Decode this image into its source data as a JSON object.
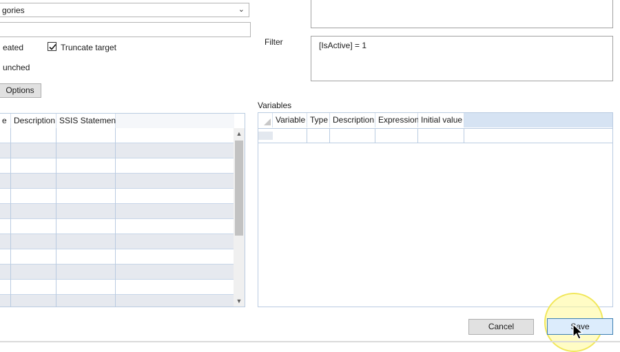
{
  "left": {
    "combo_value": "gories",
    "recreated_label": "eated",
    "truncate_label": "Truncate target",
    "truncate_checked": true,
    "launched_label": "unched",
    "options_button": "Options",
    "grid": {
      "headers": [
        "e",
        "Description",
        "SSIS Statement"
      ],
      "row_count": 12
    }
  },
  "right": {
    "filter_label": "Filter",
    "filter_value": "[IsActive] = 1",
    "variables_label": "Variables",
    "grid": {
      "headers": [
        "Variable",
        "Type",
        "Description",
        "Expression",
        "Initial value"
      ]
    }
  },
  "buttons": {
    "cancel": "Cancel",
    "save": "Save"
  },
  "icons": {
    "combo_chevron": "chevron-down-icon",
    "checkbox_mark": "check-icon",
    "row_selector": "row-selector-icon",
    "cursor": "mouse-pointer-icon"
  }
}
